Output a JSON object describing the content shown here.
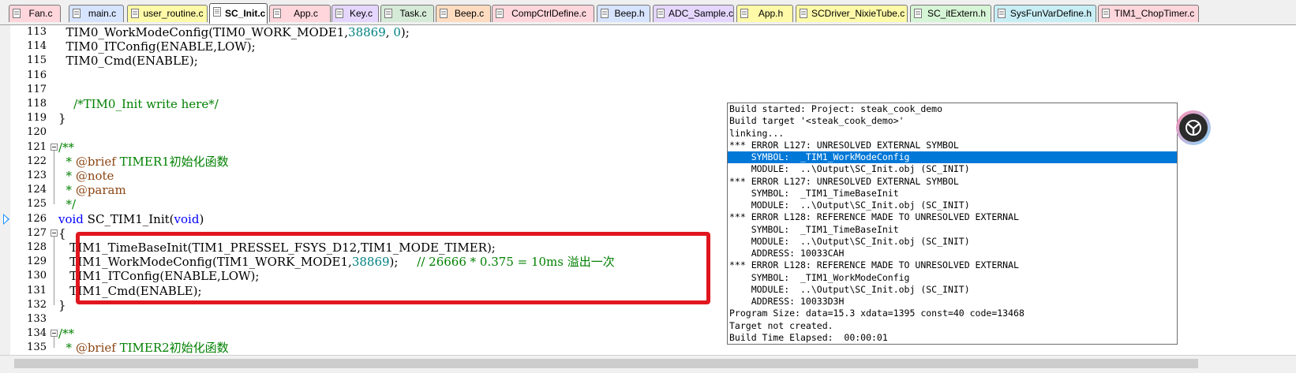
{
  "tabs": [
    {
      "label": "Fan.c",
      "color": "#ffd6dc"
    },
    {
      "label": "main.c",
      "color": "#d7e4ff"
    },
    {
      "label": "user_routine.c",
      "color": "#fffaa8"
    },
    {
      "label": "SC_Init.c",
      "color": "#ffffff",
      "active": true
    },
    {
      "label": "App.c",
      "color": "#ffd6dc"
    },
    {
      "label": "Key.c",
      "color": "#e5d6ff"
    },
    {
      "label": "Task.c",
      "color": "#d6ead8"
    },
    {
      "label": "Beep.c",
      "color": "#ffdcc0"
    },
    {
      "label": "CompCtrlDefine.c",
      "color": "#ffd6dc"
    },
    {
      "label": "Beep.h",
      "color": "#d7e4ff"
    },
    {
      "label": "ADC_Sample.c",
      "color": "#e5d6ff"
    },
    {
      "label": "App.h",
      "color": "#fffaa8"
    },
    {
      "label": "SCDriver_NixieTube.c",
      "color": "#fffaa8"
    },
    {
      "label": "SC_itExtern.h",
      "color": "#d6f5d6"
    },
    {
      "label": "SysFunVarDefine.h",
      "color": "#c8eef5"
    },
    {
      "label": "TIM1_ChopTimer.c",
      "color": "#ffd6dc"
    }
  ],
  "editor": {
    "current_line": "126",
    "lines": [
      {
        "n": "113",
        "segs": [
          {
            "t": "  TIM0_WorkModeConfig(TIM0_WORK_MODE1,"
          },
          {
            "t": "38869",
            "c": "num"
          },
          {
            "t": ", "
          },
          {
            "t": "0",
            "c": "num"
          },
          {
            "t": ");"
          }
        ]
      },
      {
        "n": "114",
        "segs": [
          {
            "t": "  TIM0_ITConfig(ENABLE,LOW);"
          }
        ]
      },
      {
        "n": "115",
        "segs": [
          {
            "t": "  TIM0_Cmd(ENABLE);"
          }
        ]
      },
      {
        "n": "116",
        "segs": []
      },
      {
        "n": "117",
        "segs": []
      },
      {
        "n": "118",
        "segs": [
          {
            "t": "    "
          },
          {
            "t": "/*TIM0_Init write here*/",
            "c": "cm"
          }
        ]
      },
      {
        "n": "119",
        "segs": [
          {
            "t": "}"
          }
        ]
      },
      {
        "n": "120",
        "segs": []
      },
      {
        "n": "121",
        "segs": [
          {
            "t": "/**",
            "c": "cm"
          }
        ]
      },
      {
        "n": "122",
        "segs": [
          {
            "t": "  * ",
            "c": "cm"
          },
          {
            "t": "@brief",
            "c": "tag"
          },
          {
            "t": " TIMER1初始化函数",
            "c": "cm"
          }
        ]
      },
      {
        "n": "123",
        "segs": [
          {
            "t": "  * ",
            "c": "cm"
          },
          {
            "t": "@note",
            "c": "tag"
          }
        ]
      },
      {
        "n": "124",
        "segs": [
          {
            "t": "  * ",
            "c": "cm"
          },
          {
            "t": "@param",
            "c": "tag"
          }
        ]
      },
      {
        "n": "125",
        "segs": [
          {
            "t": "  */",
            "c": "cm"
          }
        ]
      },
      {
        "n": "126",
        "segs": [
          {
            "t": "void",
            "c": "kw"
          },
          {
            "t": " SC_TIM1_Init("
          },
          {
            "t": "void",
            "c": "kw"
          },
          {
            "t": ")"
          }
        ]
      },
      {
        "n": "127",
        "segs": [
          {
            "t": "{"
          }
        ]
      },
      {
        "n": "128",
        "segs": [
          {
            "t": "   TIM1_TimeBaseInit(TIM1_PRESSEL_FSYS_D12,TIM1_MODE_TIMER);"
          }
        ]
      },
      {
        "n": "129",
        "segs": [
          {
            "t": "   TIM1_WorkModeConfig(TIM1_WORK_MODE1,"
          },
          {
            "t": "38869",
            "c": "num"
          },
          {
            "t": ");     "
          },
          {
            "t": "// 26666 * 0.375 = 10ms 溢出一次",
            "c": "cm"
          }
        ]
      },
      {
        "n": "130",
        "segs": [
          {
            "t": "   TIM1_ITConfig(ENABLE,LOW);"
          }
        ]
      },
      {
        "n": "131",
        "segs": [
          {
            "t": "   TIM1_Cmd(ENABLE);"
          }
        ]
      },
      {
        "n": "132",
        "segs": [
          {
            "t": "}"
          }
        ]
      },
      {
        "n": "133",
        "segs": []
      },
      {
        "n": "134",
        "segs": [
          {
            "t": "/**",
            "c": "cm"
          }
        ]
      },
      {
        "n": "135",
        "segs": [
          {
            "t": "  * ",
            "c": "cm"
          },
          {
            "t": "@brief",
            "c": "tag"
          },
          {
            "t": " TIMER2初始化函数",
            "c": "cm"
          }
        ]
      }
    ]
  },
  "build_output": {
    "selected_index": 4,
    "lines": [
      "Build started: Project: steak_cook_demo",
      "Build target '<steak_cook_demo>'",
      "linking...",
      "*** ERROR L127: UNRESOLVED EXTERNAL SYMBOL",
      "    SYMBOL:  _TIM1_WorkModeConfig",
      "    MODULE:  ..\\Output\\SC_Init.obj (SC_INIT)",
      "*** ERROR L127: UNRESOLVED EXTERNAL SYMBOL",
      "    SYMBOL:  _TIM1_TimeBaseInit",
      "    MODULE:  ..\\Output\\SC_Init.obj (SC_INIT)",
      "*** ERROR L128: REFERENCE MADE TO UNRESOLVED EXTERNAL",
      "    SYMBOL:  _TIM1_TimeBaseInit",
      "    MODULE:  ..\\Output\\SC_Init.obj (SC_INIT)",
      "    ADDRESS: 10033CAH",
      "*** ERROR L128: REFERENCE MADE TO UNRESOLVED EXTERNAL",
      "    SYMBOL:  _TIM1_WorkModeConfig",
      "    MODULE:  ..\\Output\\SC_Init.obj (SC_INIT)",
      "    ADDRESS: 10033D3H",
      "Program Size: data=15.3 xdata=1395 const=40 code=13468",
      "Target not created.",
      "Build Time Elapsed:  00:00:01"
    ]
  },
  "icons": {
    "assistant": "assistant-logo-icon",
    "current_line_marker": "current-line-arrow-icon",
    "fold": "fold-collapse-icon"
  },
  "colors": {
    "highlight_box": "#e0161e",
    "selection": "#0078d7"
  }
}
